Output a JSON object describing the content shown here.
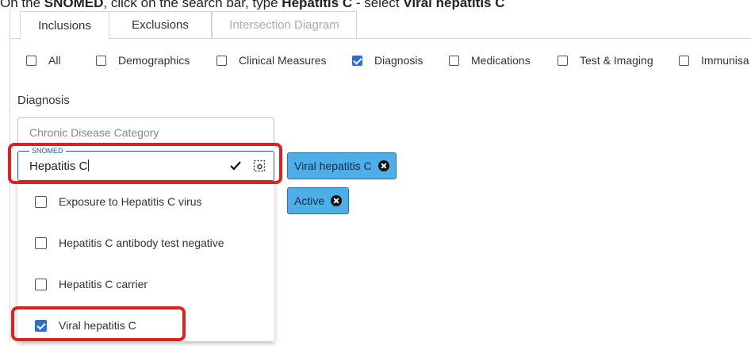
{
  "instruction": {
    "prefix": "On the ",
    "bold1": "SNOMED",
    "mid1": ", click on the search bar, type ",
    "bold2": "Hepatitis C",
    "mid2": " - select ",
    "bold3": "Viral hepatitis C"
  },
  "tabs": [
    {
      "label": "Inclusions"
    },
    {
      "label": "Exclusions"
    },
    {
      "label": "Intersection Diagram"
    }
  ],
  "categories": [
    {
      "label": "All",
      "checked": false
    },
    {
      "label": "Demographics",
      "checked": false
    },
    {
      "label": "Clinical Measures",
      "checked": false
    },
    {
      "label": "Diagnosis",
      "checked": true
    },
    {
      "label": "Medications",
      "checked": false
    },
    {
      "label": "Test & Imaging",
      "checked": false
    },
    {
      "label": "Immunisa",
      "checked": false
    }
  ],
  "section_label": "Diagnosis",
  "chronic_field": {
    "placeholder": "Chronic Disease Category"
  },
  "snomed_field": {
    "legend": "SNOMED",
    "value": "Hepatitis C"
  },
  "dropdown_options": [
    {
      "label": "Exposure to Hepatitis C virus",
      "checked": false
    },
    {
      "label": "Hepatitis C antibody test negative",
      "checked": false
    },
    {
      "label": "Hepatitis C carrier",
      "checked": false
    },
    {
      "label": "Viral hepatitis C",
      "checked": true
    }
  ],
  "chips": [
    {
      "label": "Viral hepatitis C"
    },
    {
      "label": "Active"
    }
  ],
  "colors": {
    "accent": "#2d6fd0",
    "chip": "#4eaee8",
    "highlight": "#e02020"
  },
  "icons": {
    "confirm": "checkmark-icon",
    "select": "select-all-icon",
    "remove": "remove-chip-icon"
  }
}
